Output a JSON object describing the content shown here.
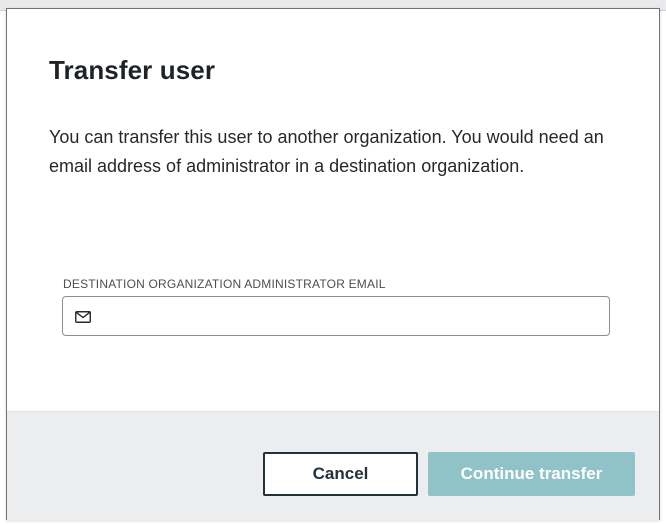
{
  "dialog": {
    "title": "Transfer user",
    "description": "You can transfer this user to another organization. You would need an email address of administrator in a destination organization.",
    "email_field": {
      "label": "DESTINATION ORGANIZATION ADMINISTRATOR EMAIL",
      "value": "",
      "placeholder": "",
      "icon": "mail-icon"
    },
    "buttons": {
      "cancel_label": "Cancel",
      "continue_label": "Continue transfer"
    }
  },
  "colors": {
    "primary_disabled": "#8fc3c8",
    "secondary_border": "#253138",
    "footer_background": "#ecedee",
    "text": "#1f2326"
  }
}
